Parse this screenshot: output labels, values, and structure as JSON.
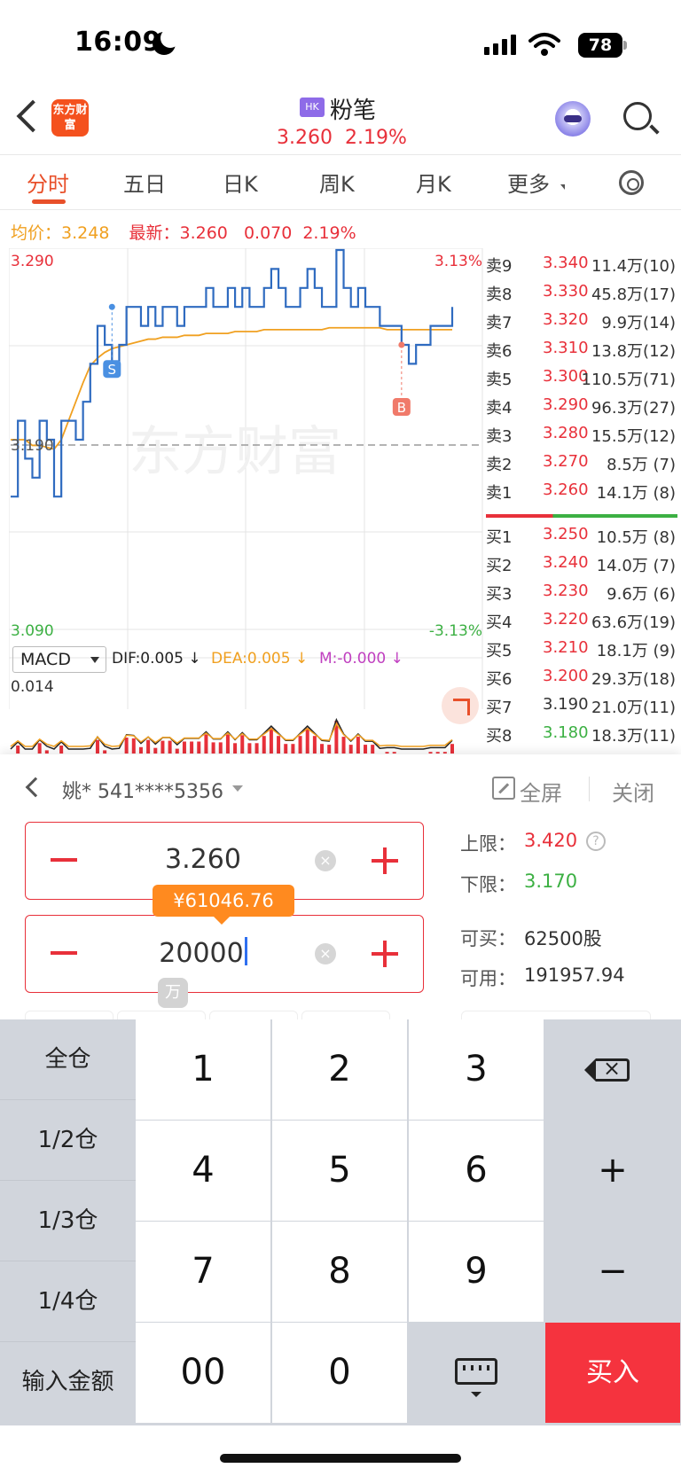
{
  "status_bar": {
    "time": "16:09",
    "battery": "78"
  },
  "header": {
    "logo_text": "东方财富",
    "market_badge": "HK",
    "stock_name": "粉笔",
    "price": "3.260",
    "change_pct": "2.19%"
  },
  "tabs": [
    "分时",
    "五日",
    "日K",
    "周K",
    "月K",
    "更多"
  ],
  "info_line": {
    "avg_label": "均价：",
    "avg_value": "3.248",
    "last_label": "最新：",
    "last_value": "3.260",
    "change": "0.070",
    "change_pct": "2.19%"
  },
  "chart_data": {
    "type": "line",
    "title": "",
    "y_max_label": "3.290",
    "y_mid_label": "3.190",
    "y_min_label": "3.090",
    "pct_max_label": "3.13%",
    "pct_min_label": "-3.13%",
    "ylim": [
      3.09,
      3.29
    ],
    "prev_close": 3.19,
    "watermark": "东方财富",
    "series": [
      {
        "name": "",
        "values": [
          3.16,
          3.2,
          3.18,
          3.17,
          3.2,
          3.19,
          3.16,
          3.2,
          3.2,
          3.19,
          3.21,
          3.23,
          3.25,
          3.24,
          3.23,
          3.24,
          3.26,
          3.26,
          3.25,
          3.26,
          3.25,
          3.26,
          3.26,
          3.25,
          3.26,
          3.26,
          3.26,
          3.27,
          3.26,
          3.26,
          3.27,
          3.26,
          3.27,
          3.26,
          3.26,
          3.27,
          3.28,
          3.27,
          3.26,
          3.26,
          3.27,
          3.28,
          3.27,
          3.26,
          3.26,
          3.29,
          3.27,
          3.26,
          3.27,
          3.26,
          3.26,
          3.25,
          3.25,
          3.25,
          3.24,
          3.23,
          3.24,
          3.24,
          3.25,
          3.25,
          3.25,
          3.26
        ]
      },
      {
        "name": "",
        "values": [
          3.19,
          3.19,
          3.19,
          3.187,
          3.187,
          3.186,
          3.185,
          3.19,
          3.2,
          3.21,
          3.22,
          3.229,
          3.233,
          3.236,
          3.238,
          3.239,
          3.24,
          3.241,
          3.242,
          3.243,
          3.243,
          3.244,
          3.244,
          3.244,
          3.245,
          3.245,
          3.245,
          3.246,
          3.246,
          3.246,
          3.246,
          3.247,
          3.247,
          3.247,
          3.247,
          3.248,
          3.248,
          3.248,
          3.248,
          3.248,
          3.248,
          3.248,
          3.248,
          3.248,
          3.249,
          3.249,
          3.249,
          3.249,
          3.249,
          3.249,
          3.249,
          3.249,
          3.248,
          3.248,
          3.248,
          3.248,
          3.248,
          3.248,
          3.248,
          3.248,
          3.248,
          3.248
        ]
      }
    ],
    "markers": [
      {
        "label": "S",
        "index": 14,
        "value": 3.26
      },
      {
        "label": "B",
        "index": 54,
        "value": 3.24
      }
    ],
    "macd": {
      "indicator": "MACD",
      "dif_label": "DIF:0.005",
      "dea_label": "DEA:0.005",
      "m_label": "M:-0.000",
      "top_label": "0.014"
    }
  },
  "order_book": {
    "asks": [
      {
        "label": "卖9",
        "price": "3.340",
        "volume": "11.4万(10)",
        "color": "#e8303a"
      },
      {
        "label": "卖8",
        "price": "3.330",
        "volume": "45.8万(17)",
        "color": "#e8303a"
      },
      {
        "label": "卖7",
        "price": "3.320",
        "volume": "9.9万(14)",
        "color": "#e8303a"
      },
      {
        "label": "卖6",
        "price": "3.310",
        "volume": "13.8万(12)",
        "color": "#e8303a"
      },
      {
        "label": "卖5",
        "price": "3.300",
        "volume": "110.5万(71)",
        "color": "#e8303a"
      },
      {
        "label": "卖4",
        "price": "3.290",
        "volume": "96.3万(27)",
        "color": "#e8303a"
      },
      {
        "label": "卖3",
        "price": "3.280",
        "volume": "15.5万(12)",
        "color": "#e8303a"
      },
      {
        "label": "卖2",
        "price": "3.270",
        "volume": "8.5万 (7)",
        "color": "#e8303a"
      },
      {
        "label": "卖1",
        "price": "3.260",
        "volume": "14.1万 (8)",
        "color": "#e8303a"
      }
    ],
    "bids": [
      {
        "label": "买1",
        "price": "3.250",
        "volume": "10.5万 (8)",
        "color": "#e8303a"
      },
      {
        "label": "买2",
        "price": "3.240",
        "volume": "14.0万 (7)",
        "color": "#e8303a"
      },
      {
        "label": "买3",
        "price": "3.230",
        "volume": "9.6万 (6)",
        "color": "#e8303a"
      },
      {
        "label": "买4",
        "price": "3.220",
        "volume": "63.6万(19)",
        "color": "#e8303a"
      },
      {
        "label": "买5",
        "price": "3.210",
        "volume": "18.1万 (9)",
        "color": "#e8303a"
      },
      {
        "label": "买6",
        "price": "3.200",
        "volume": "29.3万(18)",
        "color": "#e8303a"
      },
      {
        "label": "买7",
        "price": "3.190",
        "volume": "21.0万(11)",
        "color": "#333333"
      },
      {
        "label": "买8",
        "price": "3.180",
        "volume": "18.3万(11)",
        "color": "#3cb043"
      }
    ]
  },
  "trade_panel": {
    "account": "姚* 541****5356",
    "fullscreen_label": "全屏",
    "close_label": "关闭",
    "price_value": "3.260",
    "quantity_value": "20000",
    "amount_bubble": "¥61046.76",
    "unit_tip": "万",
    "upper_limit_label": "上限：",
    "upper_limit_value": "3.420",
    "lower_limit_label": "下限：",
    "lower_limit_value": "3.170",
    "can_buy_label": "可买：",
    "can_buy_value": "62500股",
    "available_label": "可用：",
    "available_value": "191957.94"
  },
  "keypad": {
    "side": [
      "全仓",
      "1/2仓",
      "1/3仓",
      "1/4仓",
      "输入金额"
    ],
    "digits": [
      "1",
      "2",
      "3",
      "4",
      "5",
      "6",
      "7",
      "8",
      "9",
      "00",
      "0"
    ],
    "plus": "+",
    "minus": "−",
    "buy_label": "买入"
  },
  "colors": {
    "up": "#e8303a",
    "down": "#3cb043",
    "accent": "#e8502a",
    "price_line": "#2f6bc0",
    "avg_line": "#f0a020"
  }
}
